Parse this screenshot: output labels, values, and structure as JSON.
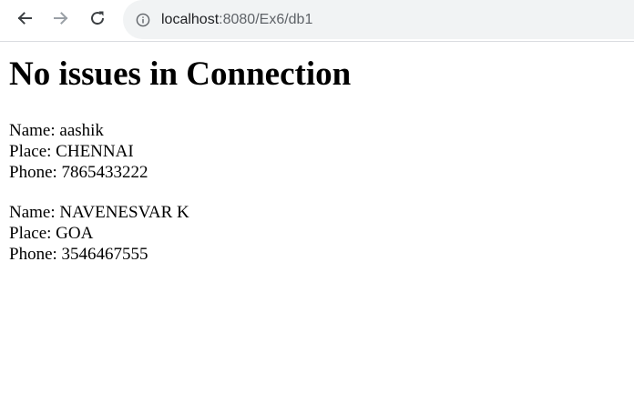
{
  "browser": {
    "url_host": "localhost",
    "url_rest": ":8080/Ex6/db1",
    "icons": {
      "back": "arrow-left-icon",
      "forward": "arrow-right-icon",
      "reload": "reload-icon",
      "info": "info-icon"
    }
  },
  "page": {
    "title": "No issues in Connection",
    "records": [
      {
        "name": "Name: aashik",
        "place": "Place: CHENNAI",
        "phone": "Phone: 7865433222"
      },
      {
        "name": "Name: NAVENESVAR K",
        "place": "Place: GOA",
        "phone": "Phone: 3546467555"
      }
    ]
  }
}
